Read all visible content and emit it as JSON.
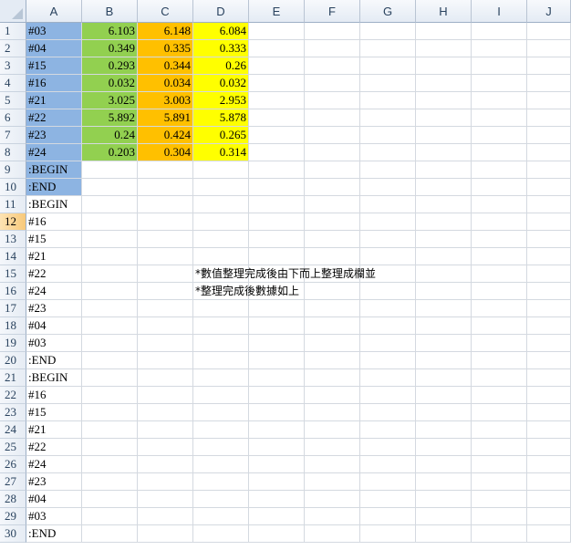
{
  "columns": [
    "A",
    "B",
    "C",
    "D",
    "E",
    "F",
    "G",
    "H",
    "I",
    "J"
  ],
  "rows": [
    "1",
    "2",
    "3",
    "4",
    "5",
    "6",
    "7",
    "8",
    "9",
    "10",
    "11",
    "12",
    "13",
    "14",
    "15",
    "16",
    "17",
    "18",
    "19",
    "20",
    "21",
    "22",
    "23",
    "24",
    "25",
    "26",
    "27",
    "28",
    "29",
    "30"
  ],
  "active_row": "12",
  "colors": {
    "col_a_fill": "#8db4e2",
    "col_b_fill": "#92d050",
    "col_c_fill": "#ffc000",
    "col_d_fill": "#ffff00",
    "grid_line": "#d4d9e0"
  },
  "col_a": [
    "#03",
    "#04",
    "#15",
    "#16",
    "#21",
    "#22",
    "#23",
    "#24",
    ":BEGIN",
    ":END",
    ":BEGIN",
    "#16",
    "#15",
    "#21",
    "#22",
    "#24",
    "#23",
    "#04",
    "#03",
    ":END",
    ":BEGIN",
    "#16",
    "#15",
    "#21",
    "#22",
    "#24",
    "#23",
    "#04",
    "#03",
    ":END"
  ],
  "col_b": [
    "6.103",
    "0.349",
    "0.293",
    "0.032",
    "3.025",
    "5.892",
    "0.24",
    "0.203"
  ],
  "col_c": [
    "6.148",
    "0.335",
    "0.344",
    "0.034",
    "3.003",
    "5.891",
    "0.424",
    "0.304"
  ],
  "col_d": [
    "6.084",
    "0.333",
    "0.26",
    "0.032",
    "2.953",
    "5.878",
    "0.265",
    "0.314"
  ],
  "notes": {
    "line1": "*數值整理完成後由下而上整理成欄並",
    "line2": "*整理完成後數據如上"
  }
}
